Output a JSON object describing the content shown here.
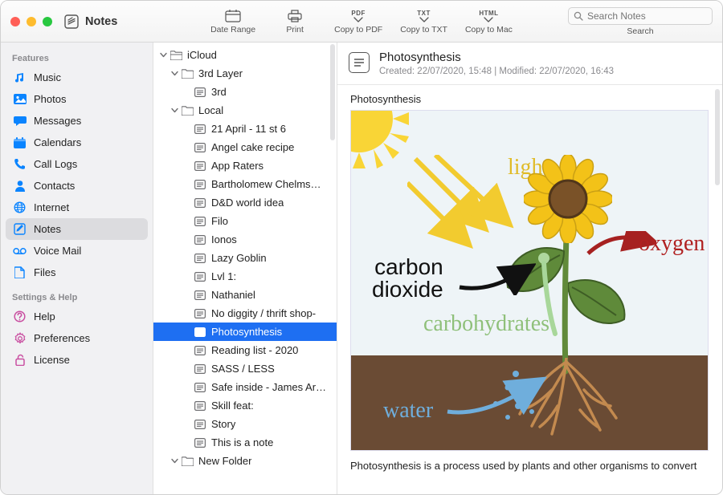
{
  "app": {
    "title": "Notes"
  },
  "toolbar": {
    "date_range": "Date Range",
    "print": "Print",
    "copy_pdf": "Copy to PDF",
    "copy_txt": "Copy to TXT",
    "copy_mac": "Copy to Mac",
    "pdf_badge": "PDF",
    "txt_badge": "TXT",
    "html_badge": "HTML",
    "search_placeholder": "Search Notes",
    "search_label": "Search"
  },
  "sidebar": {
    "features_title": "Features",
    "settings_title": "Settings & Help",
    "features": [
      {
        "label": "Music",
        "icon": "music-icon",
        "color": "#0a84ff"
      },
      {
        "label": "Photos",
        "icon": "photo-icon",
        "color": "#0a84ff"
      },
      {
        "label": "Messages",
        "icon": "chat-icon",
        "color": "#0a84ff"
      },
      {
        "label": "Calendars",
        "icon": "calendar-icon",
        "color": "#0a84ff"
      },
      {
        "label": "Call Logs",
        "icon": "phone-icon",
        "color": "#0a84ff"
      },
      {
        "label": "Contacts",
        "icon": "person-icon",
        "color": "#0a84ff"
      },
      {
        "label": "Internet",
        "icon": "globe-icon",
        "color": "#0a84ff"
      },
      {
        "label": "Notes",
        "icon": "note-icon",
        "color": "#0a84ff",
        "selected": true
      },
      {
        "label": "Voice Mail",
        "icon": "voicemail-icon",
        "color": "#0a84ff"
      },
      {
        "label": "Files",
        "icon": "file-icon",
        "color": "#0a84ff"
      }
    ],
    "settings": [
      {
        "label": "Help",
        "icon": "help-icon",
        "color": "#c94fa1"
      },
      {
        "label": "Preferences",
        "icon": "gear-icon",
        "color": "#c94fa1"
      },
      {
        "label": "License",
        "icon": "unlock-icon",
        "color": "#c94fa1"
      }
    ]
  },
  "tree": [
    {
      "indent": 0,
      "type": "folder-open",
      "label": "iCloud",
      "expanded": true
    },
    {
      "indent": 1,
      "type": "folder",
      "label": "3rd Layer",
      "expanded": true
    },
    {
      "indent": 2,
      "type": "note",
      "label": "3rd"
    },
    {
      "indent": 1,
      "type": "folder",
      "label": "Local",
      "expanded": true
    },
    {
      "indent": 2,
      "type": "note",
      "label": "21 April - 11 st 6"
    },
    {
      "indent": 2,
      "type": "note",
      "label": "Angel cake recipe"
    },
    {
      "indent": 2,
      "type": "note",
      "label": "App Raters"
    },
    {
      "indent": 2,
      "type": "note",
      "label": "Bartholomew Chelms…"
    },
    {
      "indent": 2,
      "type": "note",
      "label": "D&D world idea"
    },
    {
      "indent": 2,
      "type": "note",
      "label": "Filo"
    },
    {
      "indent": 2,
      "type": "note",
      "label": "Ionos"
    },
    {
      "indent": 2,
      "type": "note",
      "label": "Lazy Goblin"
    },
    {
      "indent": 2,
      "type": "note",
      "label": "Lvl 1:"
    },
    {
      "indent": 2,
      "type": "note",
      "label": "Nathaniel"
    },
    {
      "indent": 2,
      "type": "note",
      "label": "No diggity / thrift shop-"
    },
    {
      "indent": 2,
      "type": "note",
      "label": "Photosynthesis",
      "selected": true
    },
    {
      "indent": 2,
      "type": "note",
      "label": "Reading list - 2020"
    },
    {
      "indent": 2,
      "type": "note",
      "label": "SASS / LESS"
    },
    {
      "indent": 2,
      "type": "note",
      "label": "Safe inside - James Ar…"
    },
    {
      "indent": 2,
      "type": "note",
      "label": "Skill feat:"
    },
    {
      "indent": 2,
      "type": "note",
      "label": "Story"
    },
    {
      "indent": 2,
      "type": "note",
      "label": "This is a note"
    },
    {
      "indent": 1,
      "type": "folder",
      "label": "New Folder",
      "expanded": true
    }
  ],
  "note": {
    "title": "Photosynthesis",
    "meta": "Created: 22/07/2020, 15:48 | Modified: 22/07/2020, 16:43",
    "caption": "Photosynthesis",
    "diagram": {
      "light": "light",
      "oxygen": "oxygen",
      "co2a": "carbon",
      "co2b": "dioxide",
      "carbs": "carbohydrates",
      "water": "water"
    },
    "body_text": "Photosynthesis is a process used by plants and other organisms to convert"
  }
}
